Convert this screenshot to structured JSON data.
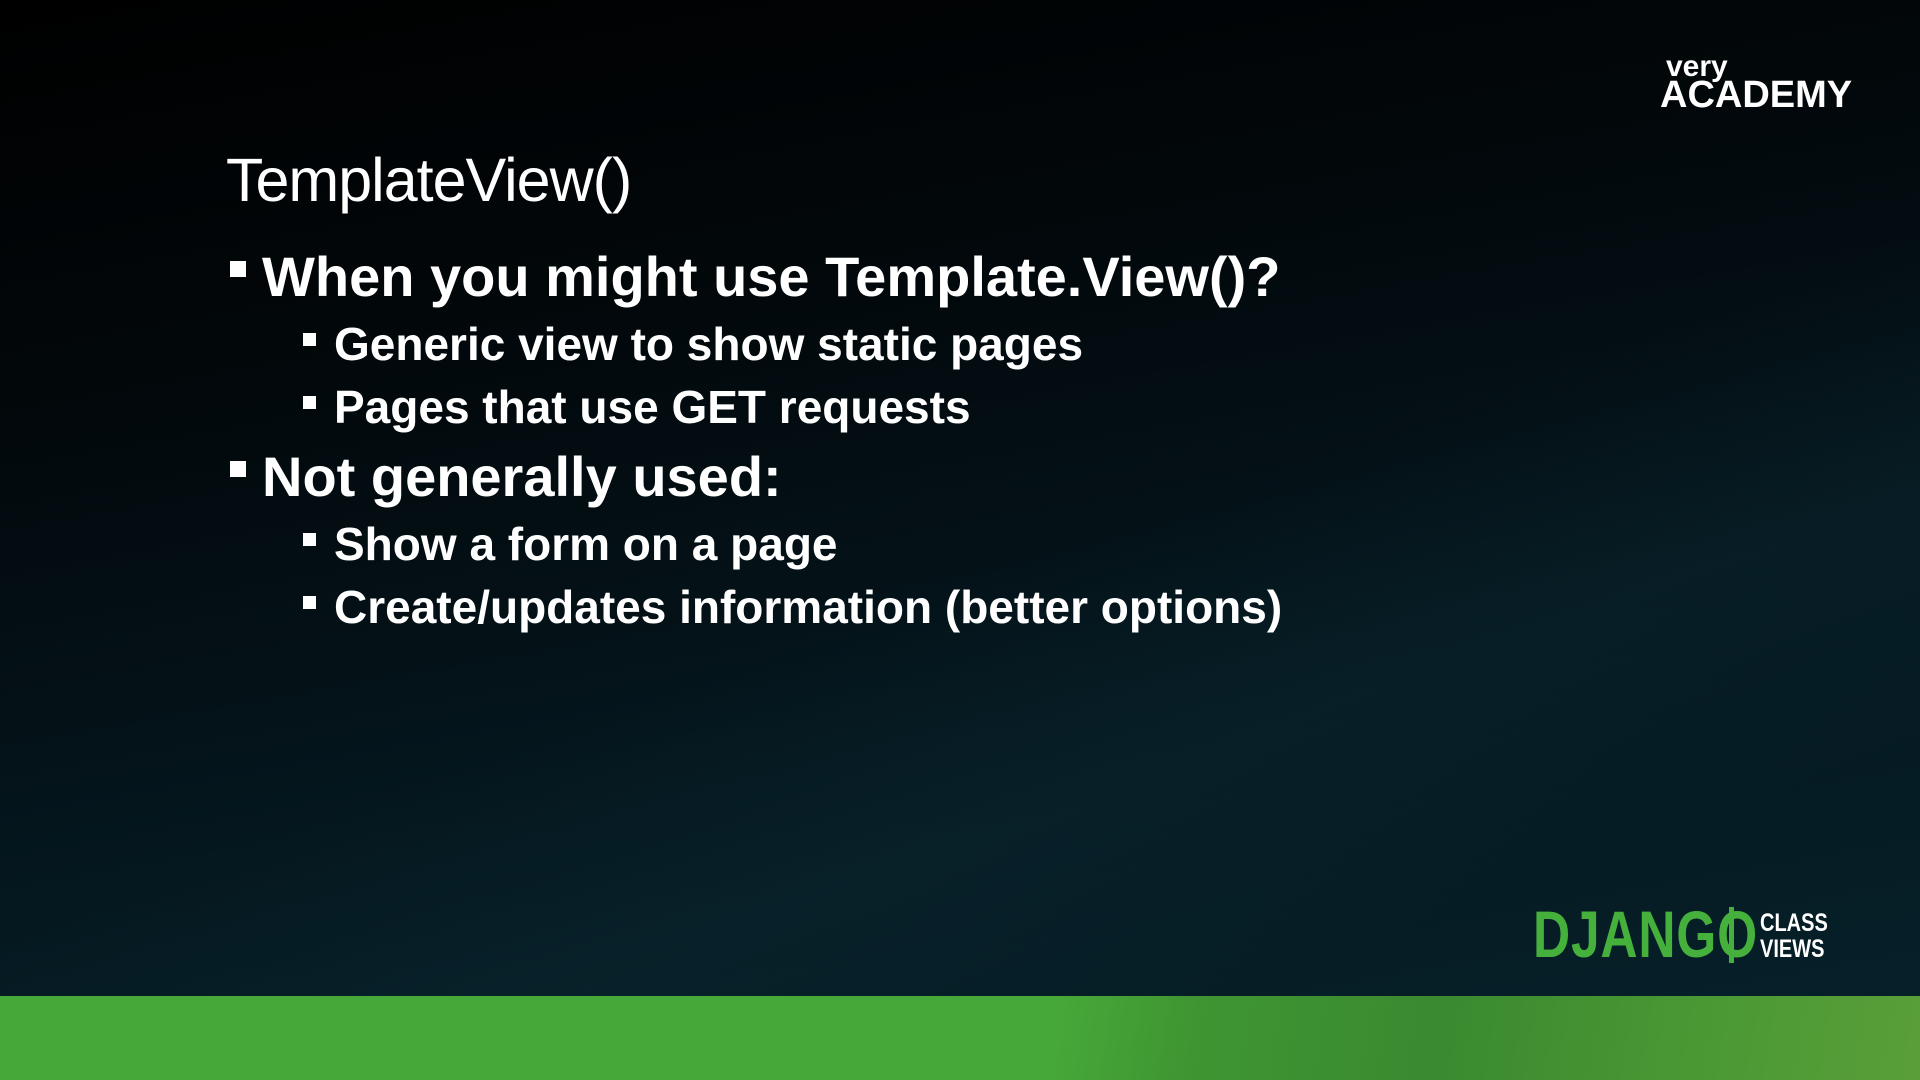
{
  "slide": {
    "title": "TemplateView()",
    "bullets": [
      {
        "text": "When you might use Template.View()?",
        "sub": [
          "Generic view to show static pages",
          "Pages that use GET requests"
        ]
      },
      {
        "text": "Not generally used:",
        "sub": [
          "Show a form on a page",
          "Create/updates information (better options)"
        ]
      }
    ]
  },
  "branding": {
    "logo_top": {
      "line1": "very",
      "line2": "ACADEMY"
    },
    "logo_bottom": {
      "main": "DJANGO",
      "line1": "CLASS",
      "line2": "VIEWS"
    }
  },
  "colors": {
    "accent_green": "#46b03c",
    "band_green": "#46a838"
  }
}
